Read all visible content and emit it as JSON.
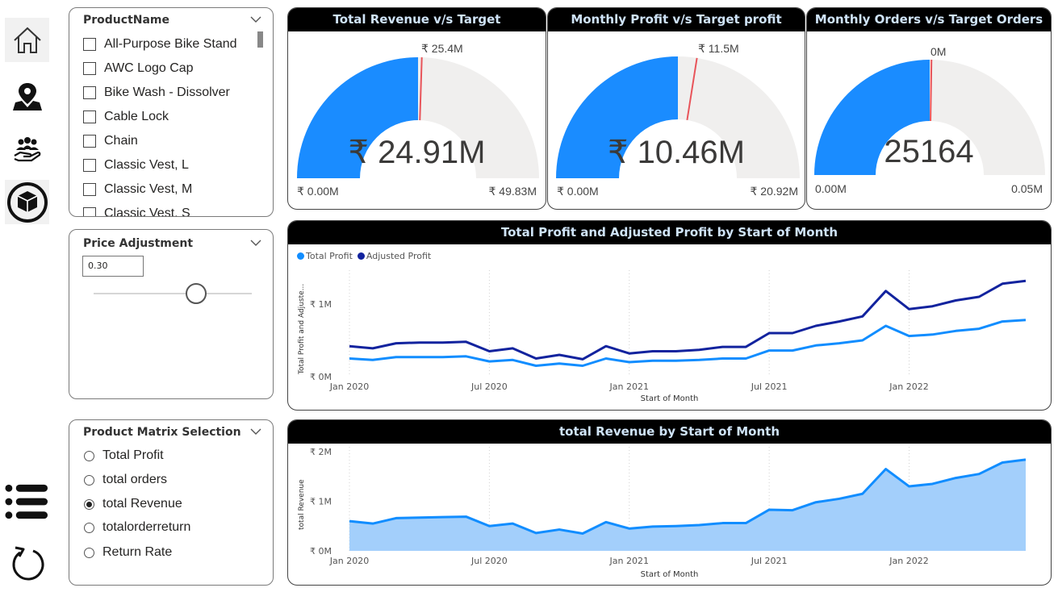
{
  "nav": {
    "icons": [
      "home-icon",
      "map-pin-icon",
      "customers-icon",
      "product-icon",
      "list-icon",
      "reset-icon"
    ]
  },
  "product_slicer": {
    "title": "ProductName",
    "items": [
      "All-Purpose Bike Stand",
      "AWC Logo Cap",
      "Bike Wash - Dissolver",
      "Cable Lock",
      "Chain",
      "Classic Vest, L",
      "Classic Vest, M",
      "Classic Vest, S"
    ]
  },
  "price_adjustment": {
    "title": "Price Adjustment",
    "value": "0.30"
  },
  "matrix_selection": {
    "title": "Product Matrix Selection",
    "options": [
      "Total Profit",
      "total orders",
      "total Revenue",
      "totalorderreturn",
      "Return Rate"
    ],
    "selected": "total Revenue"
  },
  "gauges": [
    {
      "title": "Total Revenue v/s Target",
      "value": "₹ 24.91M",
      "min": "₹ 0.00M",
      "max": "₹ 49.83M",
      "target": "₹ 25.4M",
      "fill_fraction": 0.5,
      "target_fraction": 0.51
    },
    {
      "title": "Monthly Profit v/s Target profit",
      "value": "₹ 10.46M",
      "min": "₹ 0.00M",
      "max": "₹ 20.92M",
      "target": "₹ 11.5M",
      "fill_fraction": 0.5,
      "target_fraction": 0.55
    },
    {
      "title": "Monthly Orders v/s Target Orders",
      "value": "25164",
      "min": "0.00M",
      "max": "0.05M",
      "target": "0M",
      "fill_fraction": 0.5,
      "target_fraction": 0.505
    }
  ],
  "colors": {
    "light_blue": "#118dff",
    "dark_blue": "#12239e",
    "area_fill": "#a3cffb",
    "gauge_track": "#f0efee",
    "gauge_fill": "#1a8cff",
    "target_line": "#e8545a"
  },
  "chart_data": [
    {
      "type": "line",
      "title": "Total Profit and Adjusted Profit by Start of Month",
      "xlabel": "Start of Month",
      "ylabel": "Total Profit and Adjuste...",
      "x_ticks": [
        "Jan 2020",
        "Jul 2020",
        "Jan 2021",
        "Jul 2021",
        "Jan 2022"
      ],
      "y_ticks": [
        "₹ 0M",
        "₹ 1M"
      ],
      "ylim": [
        0,
        1.4
      ],
      "x": [
        "2020-01",
        "2020-02",
        "2020-03",
        "2020-04",
        "2020-05",
        "2020-06",
        "2020-07",
        "2020-08",
        "2020-09",
        "2020-10",
        "2020-11",
        "2020-12",
        "2021-01",
        "2021-02",
        "2021-03",
        "2021-04",
        "2021-05",
        "2021-06",
        "2021-07",
        "2021-08",
        "2021-09",
        "2021-10",
        "2021-11",
        "2021-12",
        "2022-01",
        "2022-02",
        "2022-03",
        "2022-04",
        "2022-05",
        "2022-06"
      ],
      "series": [
        {
          "name": "Total Profit",
          "values": [
            0.25,
            0.23,
            0.27,
            0.27,
            0.27,
            0.28,
            0.21,
            0.23,
            0.15,
            0.18,
            0.15,
            0.25,
            0.2,
            0.22,
            0.22,
            0.23,
            0.25,
            0.25,
            0.36,
            0.36,
            0.43,
            0.46,
            0.5,
            0.7,
            0.56,
            0.58,
            0.63,
            0.66,
            0.76,
            0.78
          ]
        },
        {
          "name": "Adjusted Profit",
          "values": [
            0.42,
            0.39,
            0.46,
            0.47,
            0.47,
            0.48,
            0.35,
            0.39,
            0.25,
            0.3,
            0.24,
            0.42,
            0.32,
            0.35,
            0.35,
            0.37,
            0.41,
            0.41,
            0.6,
            0.6,
            0.7,
            0.76,
            0.83,
            1.18,
            0.93,
            0.97,
            1.05,
            1.1,
            1.28,
            1.32
          ]
        }
      ],
      "legend": "top-left"
    },
    {
      "type": "area",
      "title": "total Revenue by Start of Month",
      "xlabel": "Start of Month",
      "ylabel": "total Revenue",
      "x_ticks": [
        "Jan 2020",
        "Jul 2020",
        "Jan 2021",
        "Jul 2021",
        "Jan 2022"
      ],
      "y_ticks": [
        "₹ 0M",
        "₹ 1M",
        "₹ 2M"
      ],
      "ylim": [
        0,
        2
      ],
      "x": [
        "2020-01",
        "2020-02",
        "2020-03",
        "2020-04",
        "2020-05",
        "2020-06",
        "2020-07",
        "2020-08",
        "2020-09",
        "2020-10",
        "2020-11",
        "2020-12",
        "2021-01",
        "2021-02",
        "2021-03",
        "2021-04",
        "2021-05",
        "2021-06",
        "2021-07",
        "2021-08",
        "2021-09",
        "2021-10",
        "2021-11",
        "2021-12",
        "2022-01",
        "2022-02",
        "2022-03",
        "2022-04",
        "2022-05",
        "2022-06"
      ],
      "series": [
        {
          "name": "total Revenue",
          "values": [
            0.6,
            0.55,
            0.66,
            0.67,
            0.68,
            0.69,
            0.5,
            0.55,
            0.36,
            0.43,
            0.35,
            0.58,
            0.45,
            0.49,
            0.5,
            0.52,
            0.56,
            0.56,
            0.83,
            0.82,
            0.98,
            1.05,
            1.15,
            1.65,
            1.3,
            1.35,
            1.47,
            1.55,
            1.78,
            1.84
          ]
        }
      ]
    }
  ]
}
